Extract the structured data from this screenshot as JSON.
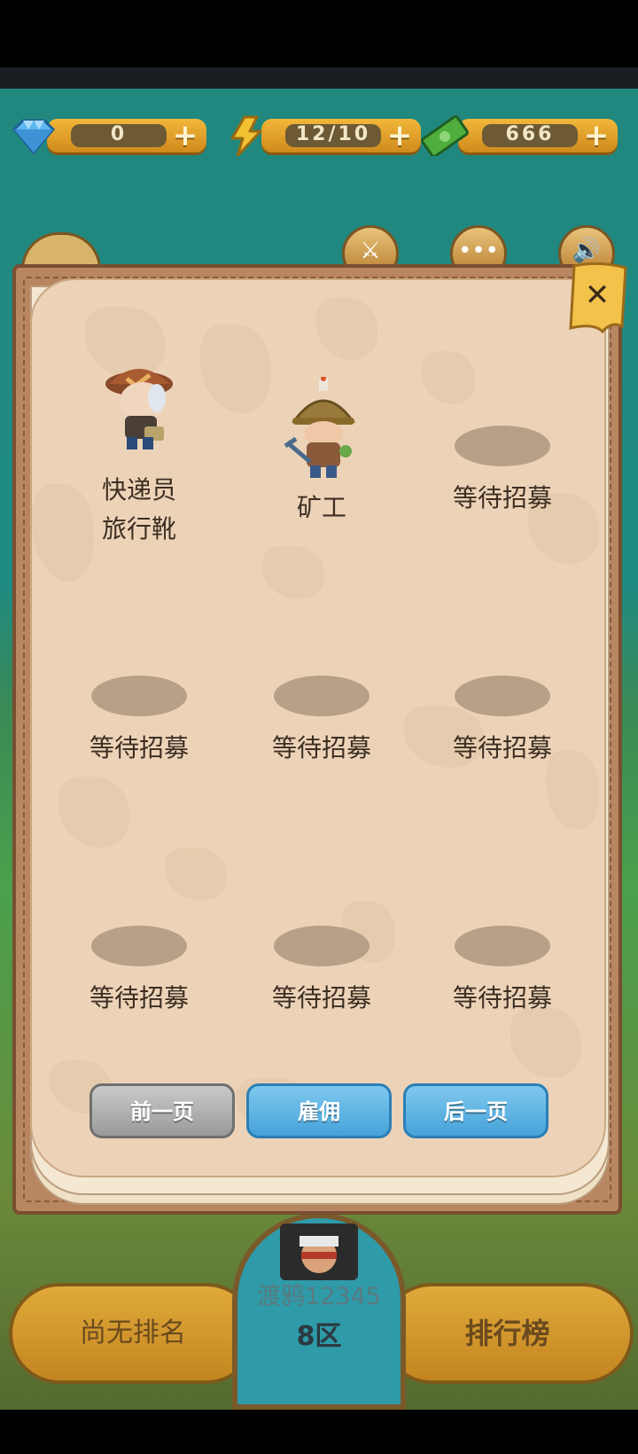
{
  "resources": {
    "diamond": {
      "value": "0",
      "icon": "diamond-icon",
      "color": "#5fb8f0"
    },
    "energy": {
      "value": "12/10",
      "icon": "lightning-icon",
      "color": "#f2c233"
    },
    "cash": {
      "value": "666",
      "icon": "cash-icon",
      "color": "#4fae3c"
    },
    "plus": "+"
  },
  "top_buttons": [
    {
      "icon": "sword-icon"
    },
    {
      "icon": "more-icon",
      "glyph": "•••"
    },
    {
      "icon": "sound-icon"
    }
  ],
  "dialog": {
    "close_glyph": "✕",
    "slots": [
      {
        "lines": [
          "快递员",
          "旅行靴"
        ],
        "character": "courier"
      },
      {
        "lines": [
          "矿工"
        ],
        "character": "miner"
      },
      {
        "lines": [
          "等待招募"
        ],
        "character": null
      },
      {
        "lines": [
          "等待招募"
        ],
        "character": null
      },
      {
        "lines": [
          "等待招募"
        ],
        "character": null
      },
      {
        "lines": [
          "等待招募"
        ],
        "character": null
      },
      {
        "lines": [
          "等待招募"
        ],
        "character": null
      },
      {
        "lines": [
          "等待招募"
        ],
        "character": null
      },
      {
        "lines": [
          "等待招募"
        ],
        "character": null
      }
    ],
    "buttons": {
      "prev": "前一页",
      "hire": "雇佣",
      "next": "后一页"
    }
  },
  "bottom_bar": {
    "rank_text": "尚无排名",
    "player_name": "渡鸦12345",
    "zone": "8区",
    "leaderboard": "排行榜"
  }
}
